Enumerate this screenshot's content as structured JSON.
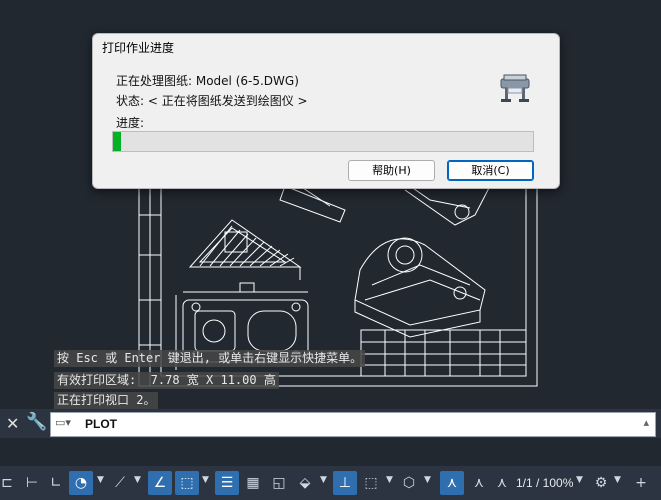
{
  "dialog": {
    "title": "打印作业进度",
    "processing_line": "正在处理图纸: Model (6-5.DWG)",
    "status_line": "状态: < 正在将图纸发送到绘图仪 >",
    "progress_label": "进度:",
    "progress_fraction": 0.02,
    "help_button": "帮助(H)",
    "cancel_button": "取消(C)",
    "plotter_icon": "plotter-icon"
  },
  "command_history": [
    "按 Esc 或 Enter 键退出, 或单击右键显示快捷菜单。",
    "有效打印区域:  7.78 宽 X 11.00 高",
    "正在打印视口 2。"
  ],
  "command_line": {
    "close_icon": "close-icon",
    "settings_icon": "wrench-icon",
    "input_value": "PLOT"
  },
  "status_bar": {
    "annotation_scale": "1/1 / 100%"
  },
  "colors": {
    "workspace_bg": "#212830",
    "drawing_lines": "#ffffff",
    "progress_fill": "#06b025",
    "statusbar_active": "#2f6fb0"
  }
}
